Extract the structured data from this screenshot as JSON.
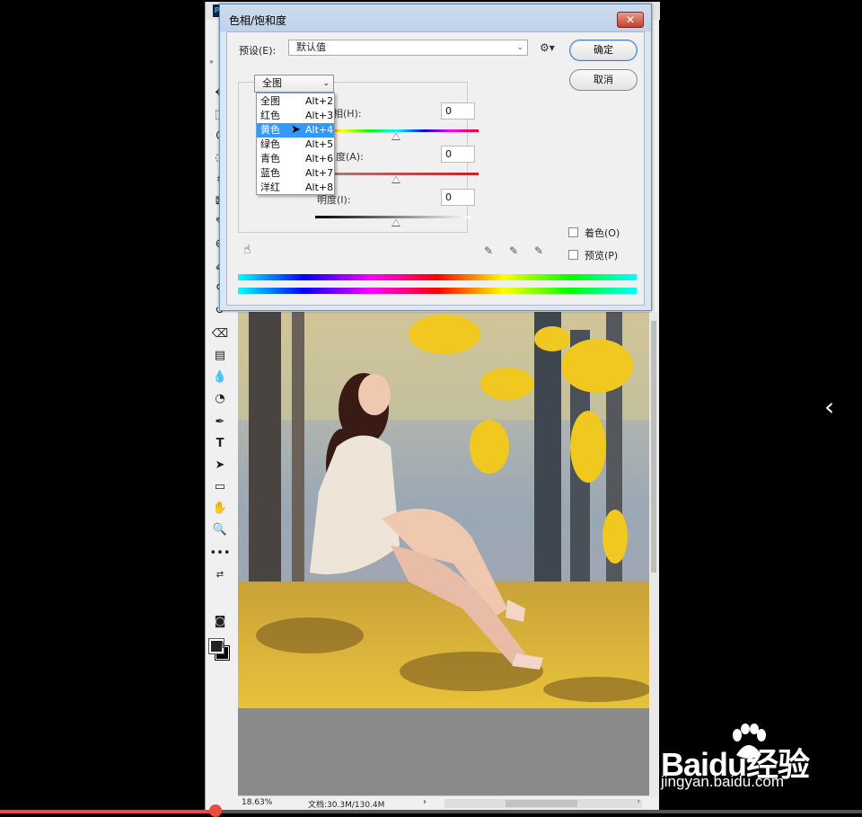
{
  "dialog": {
    "title": "色相/饱和度",
    "close_label": "✕",
    "preset_label": "预设(E):",
    "preset_value": "默认值",
    "ok_label": "确定",
    "cancel_label": "取消",
    "channel_value": "全图",
    "hue_label": "相(H):",
    "hue_value": "0",
    "saturation_label": "和度(A):",
    "saturation_value": "0",
    "lightness_label": "明度(I):",
    "lightness_value": "0",
    "colorize_label": "着色(O)",
    "preview_label": "预览(P)",
    "channel_options": [
      {
        "name": "全图",
        "shortcut": "Alt+2"
      },
      {
        "name": "红色",
        "shortcut": "Alt+3"
      },
      {
        "name": "黄色",
        "shortcut": "Alt+4"
      },
      {
        "name": "绿色",
        "shortcut": "Alt+5"
      },
      {
        "name": "青色",
        "shortcut": "Alt+6"
      },
      {
        "name": "蓝色",
        "shortcut": "Alt+7"
      },
      {
        "name": "洋红",
        "shortcut": "Alt+8"
      }
    ],
    "selected_option": "黄色"
  },
  "app": {
    "logo_text": "Ps",
    "collapse_label": "»"
  },
  "status": {
    "zoom": "18.63%",
    "doc_info": "文档:30.3M/130.4M",
    "arrow": "›"
  },
  "watermark": {
    "main": "Baidu经验",
    "sub": "jingyan.baidu.com"
  },
  "nav": {
    "prev_arrow": "‹"
  },
  "video_progress": 0.25,
  "colors": {
    "dialog_frame": "#dce6f2",
    "selection": "#3399ff",
    "progress": "#e74c3c"
  }
}
